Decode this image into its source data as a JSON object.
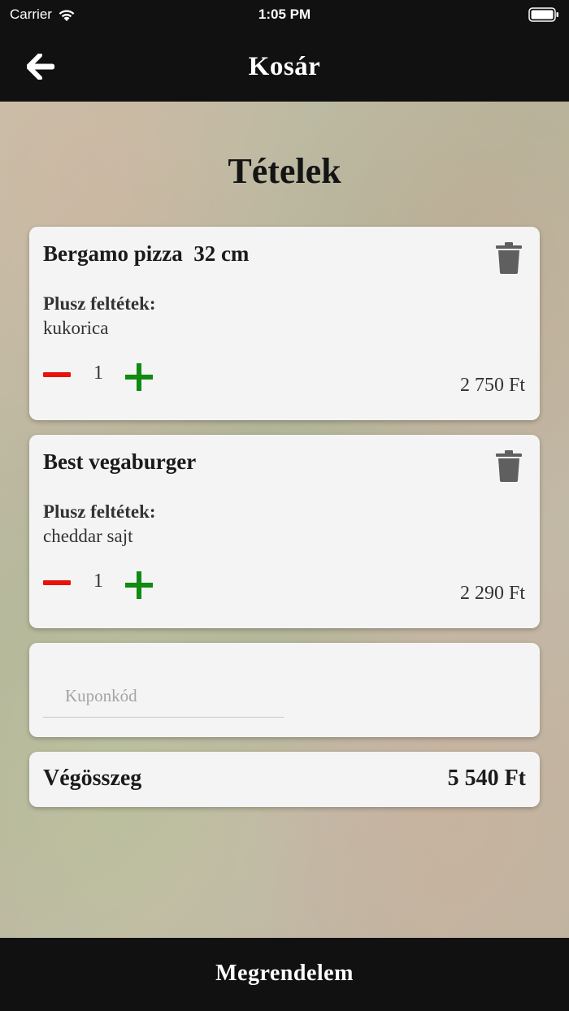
{
  "status_bar": {
    "carrier": "Carrier",
    "time": "1:05 PM"
  },
  "nav": {
    "title": "Kosár",
    "back_icon": "arrow-left-icon"
  },
  "cart": {
    "title": "Tételek",
    "items": [
      {
        "name": "Bergamo pizza  32 cm",
        "extras_label": "Plusz feltétek:",
        "extras": "kukorica",
        "quantity": "1",
        "price": "2 750 Ft"
      },
      {
        "name": "Best vegaburger",
        "extras_label": "Plusz feltétek:",
        "extras": "cheddar sajt",
        "quantity": "1",
        "price": "2 290 Ft"
      }
    ],
    "coupon": {
      "placeholder": "Kuponkód",
      "value": ""
    },
    "total": {
      "label": "Végösszeg",
      "value": "5 540 Ft"
    }
  },
  "order_button": {
    "label": "Megrendelem"
  },
  "colors": {
    "minus": "#e8120c",
    "plus": "#118a11",
    "bar": "#111111",
    "card": "#f4f4f4"
  }
}
